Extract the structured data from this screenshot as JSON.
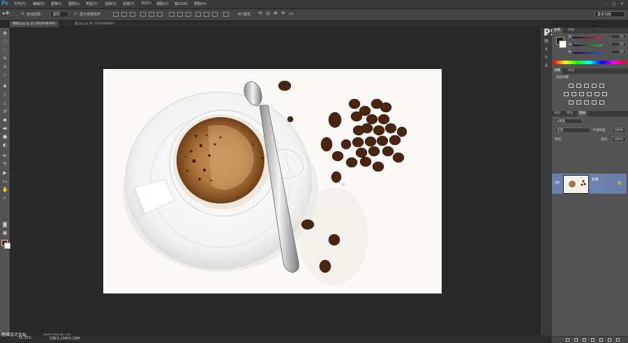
{
  "app": {
    "logo": "Ps",
    "workspace": "基本功能"
  },
  "menu": [
    "文件(F)",
    "编辑(E)",
    "图像(I)",
    "图层(L)",
    "类型(Y)",
    "选择(S)",
    "滤镜(T)",
    "3D(D)",
    "视图(V)",
    "窗口(W)",
    "帮助(H)"
  ],
  "options_bar": {
    "auto_select_label": "自动选择：",
    "auto_select_value": "图层",
    "show_transform_label": "显示变换控件",
    "mode_3d_label": "3D 模式："
  },
  "tabs": [
    {
      "label": "咖啡.jpg @ 33.3%(RGB/8#)"
    },
    {
      "label": "猫.jpg @ 66.7%(RGB/8#)"
    }
  ],
  "color_panel": {
    "tabs": [
      "颜色",
      "色板"
    ],
    "sliders": [
      {
        "label": "R",
        "value": "32",
        "color": "#e03030"
      },
      {
        "label": "G",
        "value": "22",
        "color": "#30c030"
      },
      {
        "label": "B",
        "value": "32",
        "color": "#3050e0"
      }
    ]
  },
  "adjust_panel": {
    "tabs": [
      "调整",
      "样式"
    ],
    "title": "添加调整"
  },
  "layers_panel": {
    "tabs": [
      "通道",
      "路径",
      "图层"
    ],
    "kind_label": "ρ类型",
    "blend_mode": "正常",
    "opacity_label": "不透明度:",
    "opacity_value": "100%",
    "lock_label": "锁定:",
    "fill_label": "填充:",
    "fill_value": "100%",
    "layer_name": "背景"
  },
  "status": {
    "zoom": "33.33%",
    "doc_info": "文档:5.29M/5.29M"
  },
  "watermark": "PS教程云课堂",
  "bottom_left_watermark": "思缘设计论坛",
  "bottom_url": "www.missyuan.com"
}
